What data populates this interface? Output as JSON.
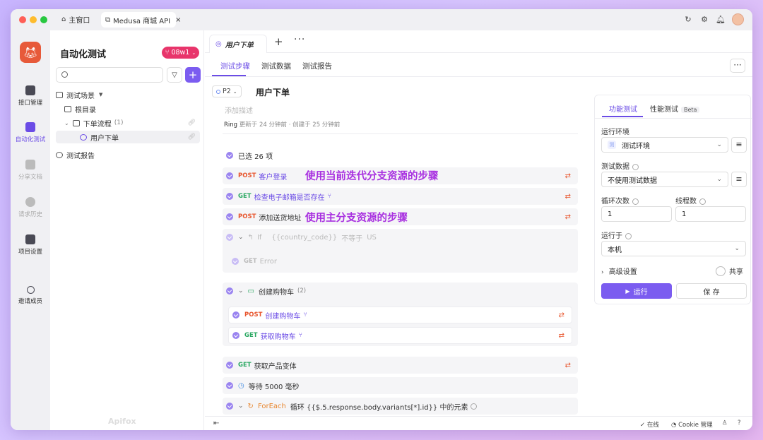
{
  "titlebar": {
    "home_tab": "主窗口",
    "api_tab": "Medusa 商城 API",
    "close": "×"
  },
  "nav": {
    "items": [
      {
        "label": "接口管理",
        "state": "normal"
      },
      {
        "label": "自动化测试",
        "state": "active"
      },
      {
        "label": "分享文档",
        "state": "dim"
      },
      {
        "label": "请求历史",
        "state": "dim"
      },
      {
        "label": "项目设置",
        "state": "normal"
      },
      {
        "label": "邀请成员",
        "state": "normal"
      }
    ]
  },
  "tree": {
    "title": "自动化测试",
    "branch": "08w1",
    "section_scenes": "测试场景",
    "root": "根目录",
    "folder": "下单流程",
    "folder_count": "(1)",
    "case": "用户下单",
    "reports": "测试报告",
    "watermark": "Apifox"
  },
  "main": {
    "doc_tab": "用户下单",
    "subtabs": [
      "测试步骤",
      "测试数据",
      "测试报告"
    ],
    "priority": "P2",
    "case_title": "用户下单",
    "add_desc": "添加描述",
    "meta_user": "Ring",
    "meta_text": "更新于 24 分钟前 · 创建于 25 分钟前",
    "selected": "已选 26 项",
    "steps": {
      "s1": {
        "method": "POST",
        "name": "客户登录"
      },
      "s2": {
        "method": "GET",
        "name": "检查电子邮箱是否存在"
      },
      "s3": {
        "method": "POST",
        "name": "添加送货地址"
      },
      "if_label": "If",
      "if_cond": "{{country_code}}",
      "if_op": "不等于",
      "if_val": "US",
      "if_inner": {
        "method": "GET",
        "name": "Error"
      },
      "group_name": "创建购物车",
      "group_count": "(2)",
      "g1": {
        "method": "POST",
        "name": "创建购物车"
      },
      "g2": {
        "method": "GET",
        "name": "获取购物车"
      },
      "s4": {
        "method": "GET",
        "name": "获取产品变体"
      },
      "wait": "等待 5000 毫秒",
      "foreach": "ForEach",
      "foreach_text": "循环 {{$.5.response.body.variants[*].id}} 中的元素"
    },
    "annot_iter": "使用当前迭代分支资源的步骤",
    "annot_main": "使用主分支资源的步骤"
  },
  "panel": {
    "tab_func": "功能测试",
    "tab_perf": "性能测试",
    "beta": "Beta",
    "env_label": "运行环境",
    "env_icon": "测",
    "env_value": "测试环境",
    "data_label": "测试数据",
    "data_value": "不使用测试数据",
    "loop_label": "循环次数",
    "loop_value": "1",
    "thread_label": "线程数",
    "thread_value": "1",
    "run_on_label": "运行于",
    "run_on_value": "本机",
    "advanced": "高级设置",
    "share": "共享",
    "run": "运行",
    "save": "保 存"
  },
  "status": {
    "online": "在线",
    "cookie": "Cookie 管理"
  },
  "colors": {
    "accent": "#6b4ce6",
    "branch": "#e8356b",
    "post": "#e8562e",
    "get": "#2aa862",
    "annotation": "#a830e0"
  }
}
